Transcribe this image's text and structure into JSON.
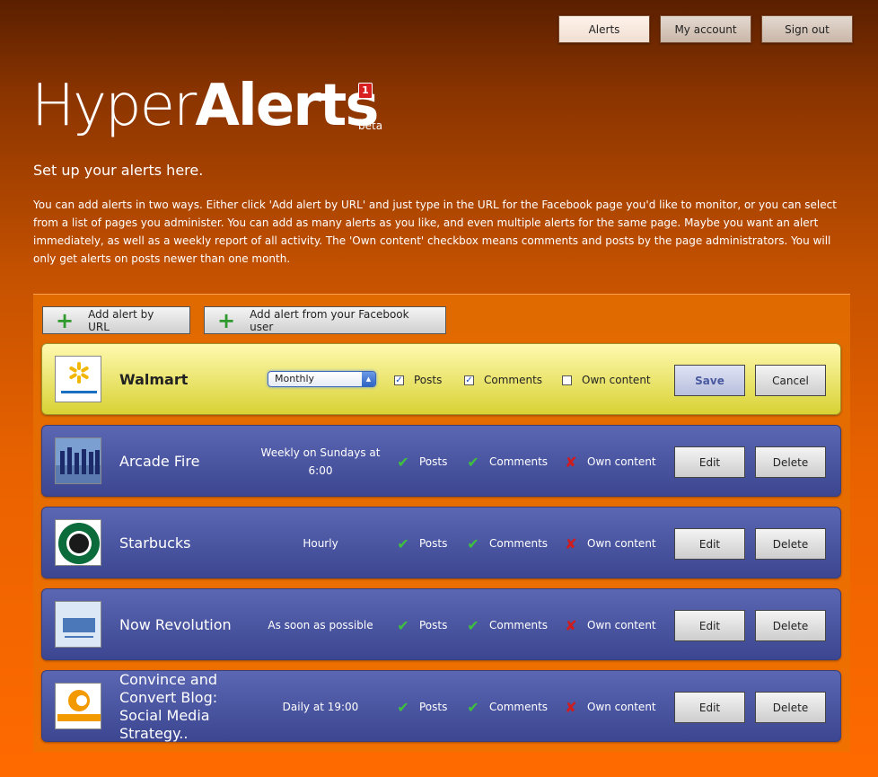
{
  "nav": {
    "items": [
      "Alerts",
      "My account",
      "Sign out"
    ]
  },
  "logo": {
    "light": "Hyper",
    "bold": "Alerts",
    "badge": "1",
    "beta": "beta"
  },
  "subtitle": "Set up your alerts here.",
  "intro": "You can add alerts in two ways. Either click 'Add alert by URL' and just type in the URL for the Facebook page you'd like to monitor, or you can select from a list of pages you administer. You can add as many alerts as you like, and even multiple alerts for the same page. Maybe you want an alert immediately, as well as a weekly report of all activity. The 'Own content' checkbox means comments and posts by the page administrators. You will only get alerts on posts newer than one month.",
  "add_buttons": {
    "by_url": "Add alert by URL",
    "from_facebook": "Add alert from your Facebook user"
  },
  "labels": {
    "posts": "Posts",
    "comments": "Comments",
    "own_content": "Own content",
    "save": "Save",
    "cancel": "Cancel",
    "edit": "Edit",
    "delete": "Delete"
  },
  "editing": {
    "name": "Walmart",
    "frequency": "Monthly",
    "posts": true,
    "comments": true,
    "own_content": false
  },
  "alerts": [
    {
      "name": "Arcade Fire",
      "frequency": "Weekly on Sundays at 6:00",
      "posts": true,
      "comments": true,
      "own_content": false
    },
    {
      "name": "Starbucks",
      "frequency": "Hourly",
      "posts": true,
      "comments": true,
      "own_content": false
    },
    {
      "name": "Now Revolution",
      "frequency": "As soon as possible",
      "posts": true,
      "comments": true,
      "own_content": false
    },
    {
      "name": "Convince and Convert Blog: Social Media Strategy..",
      "frequency": "Daily at 19:00",
      "posts": true,
      "comments": true,
      "own_content": false
    }
  ],
  "colors": {
    "accent": "#ff6a00",
    "row_blue": "#4a56a3",
    "edit_yellow": "#f2ec7a",
    "check_green": "#3fbf3f",
    "cross_red": "#d01c1c"
  }
}
